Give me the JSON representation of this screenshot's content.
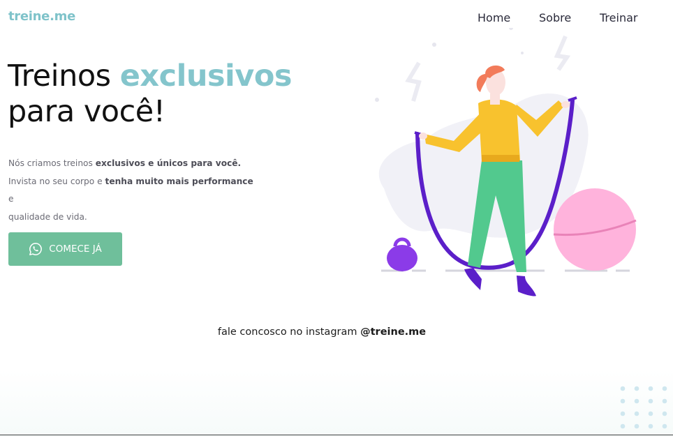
{
  "brand": {
    "logo": "treine.me"
  },
  "nav": {
    "items": [
      {
        "label": "Home"
      },
      {
        "label": "Sobre"
      },
      {
        "label": "Treinar"
      }
    ]
  },
  "hero": {
    "title_line1_plain": "Treinos ",
    "title_line1_accent": "exclusivos",
    "title_line2": "para você!",
    "text": {
      "p1": "Nós criamos treinos ",
      "p1_bold": "exclusivos e únicos para você.",
      "p2": "Invista no seu corpo e ",
      "p2_bold": "tenha muito mais performance",
      "p2_end": " e",
      "p3": "qualidade de vida."
    },
    "cta_label": "COMECE JÁ",
    "cta_icon": "whatsapp-icon"
  },
  "footer": {
    "insta_text": "fale concosco no instagram ",
    "insta_handle": "@treine.me"
  },
  "colors": {
    "accent": "#84c5cc",
    "cta": "#6fbf9b",
    "rope": "#5b1fc9",
    "ball": "#ffb3dc",
    "pants": "#52c98e",
    "hoodie": "#f8c22e",
    "hair": "#f27b5a"
  }
}
